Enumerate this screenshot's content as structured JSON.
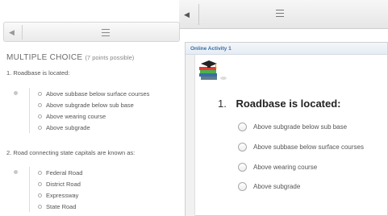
{
  "left_panel": {
    "section_title": "MULTIPLE CHOICE",
    "section_hint": "(7 points possible)",
    "questions": [
      {
        "label": "1. Roadbase is located:",
        "options": [
          "Above subbase below surface courses",
          "Above subgrade below sub base",
          "Above wearing course",
          "Above subgrade"
        ]
      },
      {
        "label": "2. Road connecting state capitals are known as:",
        "options": [
          "Federal Road",
          "District Road",
          "Expressway",
          "State Road"
        ]
      }
    ]
  },
  "activity": {
    "header": "Online Activity 1",
    "question_number": "1.",
    "question_text": "Roadbase is located:",
    "options": [
      "Above subgrade below sub base",
      "Above subbase below surface courses",
      "Above wearing course",
      "Above subgrade"
    ]
  },
  "icons": {
    "nav_arrow": "left-triangle-icon",
    "menu": "hamburger-menu-icon",
    "activity_image": "books-graduation-cap-icon"
  },
  "colors": {
    "header_text": "#3a6ea5",
    "question_text": "#222222"
  }
}
